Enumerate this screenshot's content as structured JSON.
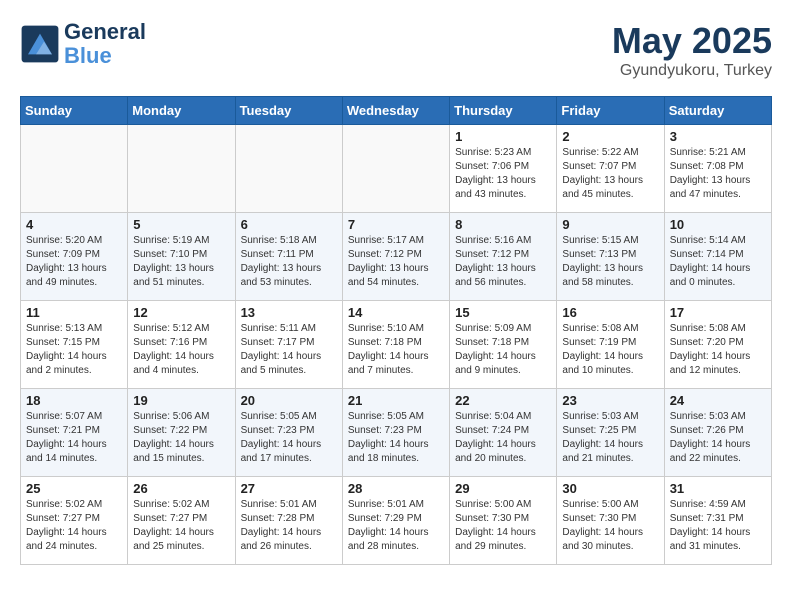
{
  "header": {
    "logo_line1": "General",
    "logo_line2": "Blue",
    "month": "May 2025",
    "location": "Gyundyukoru, Turkey"
  },
  "weekdays": [
    "Sunday",
    "Monday",
    "Tuesday",
    "Wednesday",
    "Thursday",
    "Friday",
    "Saturday"
  ],
  "weeks": [
    [
      {
        "day": "",
        "info": ""
      },
      {
        "day": "",
        "info": ""
      },
      {
        "day": "",
        "info": ""
      },
      {
        "day": "",
        "info": ""
      },
      {
        "day": "1",
        "info": "Sunrise: 5:23 AM\nSunset: 7:06 PM\nDaylight: 13 hours\nand 43 minutes."
      },
      {
        "day": "2",
        "info": "Sunrise: 5:22 AM\nSunset: 7:07 PM\nDaylight: 13 hours\nand 45 minutes."
      },
      {
        "day": "3",
        "info": "Sunrise: 5:21 AM\nSunset: 7:08 PM\nDaylight: 13 hours\nand 47 minutes."
      }
    ],
    [
      {
        "day": "4",
        "info": "Sunrise: 5:20 AM\nSunset: 7:09 PM\nDaylight: 13 hours\nand 49 minutes."
      },
      {
        "day": "5",
        "info": "Sunrise: 5:19 AM\nSunset: 7:10 PM\nDaylight: 13 hours\nand 51 minutes."
      },
      {
        "day": "6",
        "info": "Sunrise: 5:18 AM\nSunset: 7:11 PM\nDaylight: 13 hours\nand 53 minutes."
      },
      {
        "day": "7",
        "info": "Sunrise: 5:17 AM\nSunset: 7:12 PM\nDaylight: 13 hours\nand 54 minutes."
      },
      {
        "day": "8",
        "info": "Sunrise: 5:16 AM\nSunset: 7:12 PM\nDaylight: 13 hours\nand 56 minutes."
      },
      {
        "day": "9",
        "info": "Sunrise: 5:15 AM\nSunset: 7:13 PM\nDaylight: 13 hours\nand 58 minutes."
      },
      {
        "day": "10",
        "info": "Sunrise: 5:14 AM\nSunset: 7:14 PM\nDaylight: 14 hours\nand 0 minutes."
      }
    ],
    [
      {
        "day": "11",
        "info": "Sunrise: 5:13 AM\nSunset: 7:15 PM\nDaylight: 14 hours\nand 2 minutes."
      },
      {
        "day": "12",
        "info": "Sunrise: 5:12 AM\nSunset: 7:16 PM\nDaylight: 14 hours\nand 4 minutes."
      },
      {
        "day": "13",
        "info": "Sunrise: 5:11 AM\nSunset: 7:17 PM\nDaylight: 14 hours\nand 5 minutes."
      },
      {
        "day": "14",
        "info": "Sunrise: 5:10 AM\nSunset: 7:18 PM\nDaylight: 14 hours\nand 7 minutes."
      },
      {
        "day": "15",
        "info": "Sunrise: 5:09 AM\nSunset: 7:18 PM\nDaylight: 14 hours\nand 9 minutes."
      },
      {
        "day": "16",
        "info": "Sunrise: 5:08 AM\nSunset: 7:19 PM\nDaylight: 14 hours\nand 10 minutes."
      },
      {
        "day": "17",
        "info": "Sunrise: 5:08 AM\nSunset: 7:20 PM\nDaylight: 14 hours\nand 12 minutes."
      }
    ],
    [
      {
        "day": "18",
        "info": "Sunrise: 5:07 AM\nSunset: 7:21 PM\nDaylight: 14 hours\nand 14 minutes."
      },
      {
        "day": "19",
        "info": "Sunrise: 5:06 AM\nSunset: 7:22 PM\nDaylight: 14 hours\nand 15 minutes."
      },
      {
        "day": "20",
        "info": "Sunrise: 5:05 AM\nSunset: 7:23 PM\nDaylight: 14 hours\nand 17 minutes."
      },
      {
        "day": "21",
        "info": "Sunrise: 5:05 AM\nSunset: 7:23 PM\nDaylight: 14 hours\nand 18 minutes."
      },
      {
        "day": "22",
        "info": "Sunrise: 5:04 AM\nSunset: 7:24 PM\nDaylight: 14 hours\nand 20 minutes."
      },
      {
        "day": "23",
        "info": "Sunrise: 5:03 AM\nSunset: 7:25 PM\nDaylight: 14 hours\nand 21 minutes."
      },
      {
        "day": "24",
        "info": "Sunrise: 5:03 AM\nSunset: 7:26 PM\nDaylight: 14 hours\nand 22 minutes."
      }
    ],
    [
      {
        "day": "25",
        "info": "Sunrise: 5:02 AM\nSunset: 7:27 PM\nDaylight: 14 hours\nand 24 minutes."
      },
      {
        "day": "26",
        "info": "Sunrise: 5:02 AM\nSunset: 7:27 PM\nDaylight: 14 hours\nand 25 minutes."
      },
      {
        "day": "27",
        "info": "Sunrise: 5:01 AM\nSunset: 7:28 PM\nDaylight: 14 hours\nand 26 minutes."
      },
      {
        "day": "28",
        "info": "Sunrise: 5:01 AM\nSunset: 7:29 PM\nDaylight: 14 hours\nand 28 minutes."
      },
      {
        "day": "29",
        "info": "Sunrise: 5:00 AM\nSunset: 7:30 PM\nDaylight: 14 hours\nand 29 minutes."
      },
      {
        "day": "30",
        "info": "Sunrise: 5:00 AM\nSunset: 7:30 PM\nDaylight: 14 hours\nand 30 minutes."
      },
      {
        "day": "31",
        "info": "Sunrise: 4:59 AM\nSunset: 7:31 PM\nDaylight: 14 hours\nand 31 minutes."
      }
    ]
  ]
}
